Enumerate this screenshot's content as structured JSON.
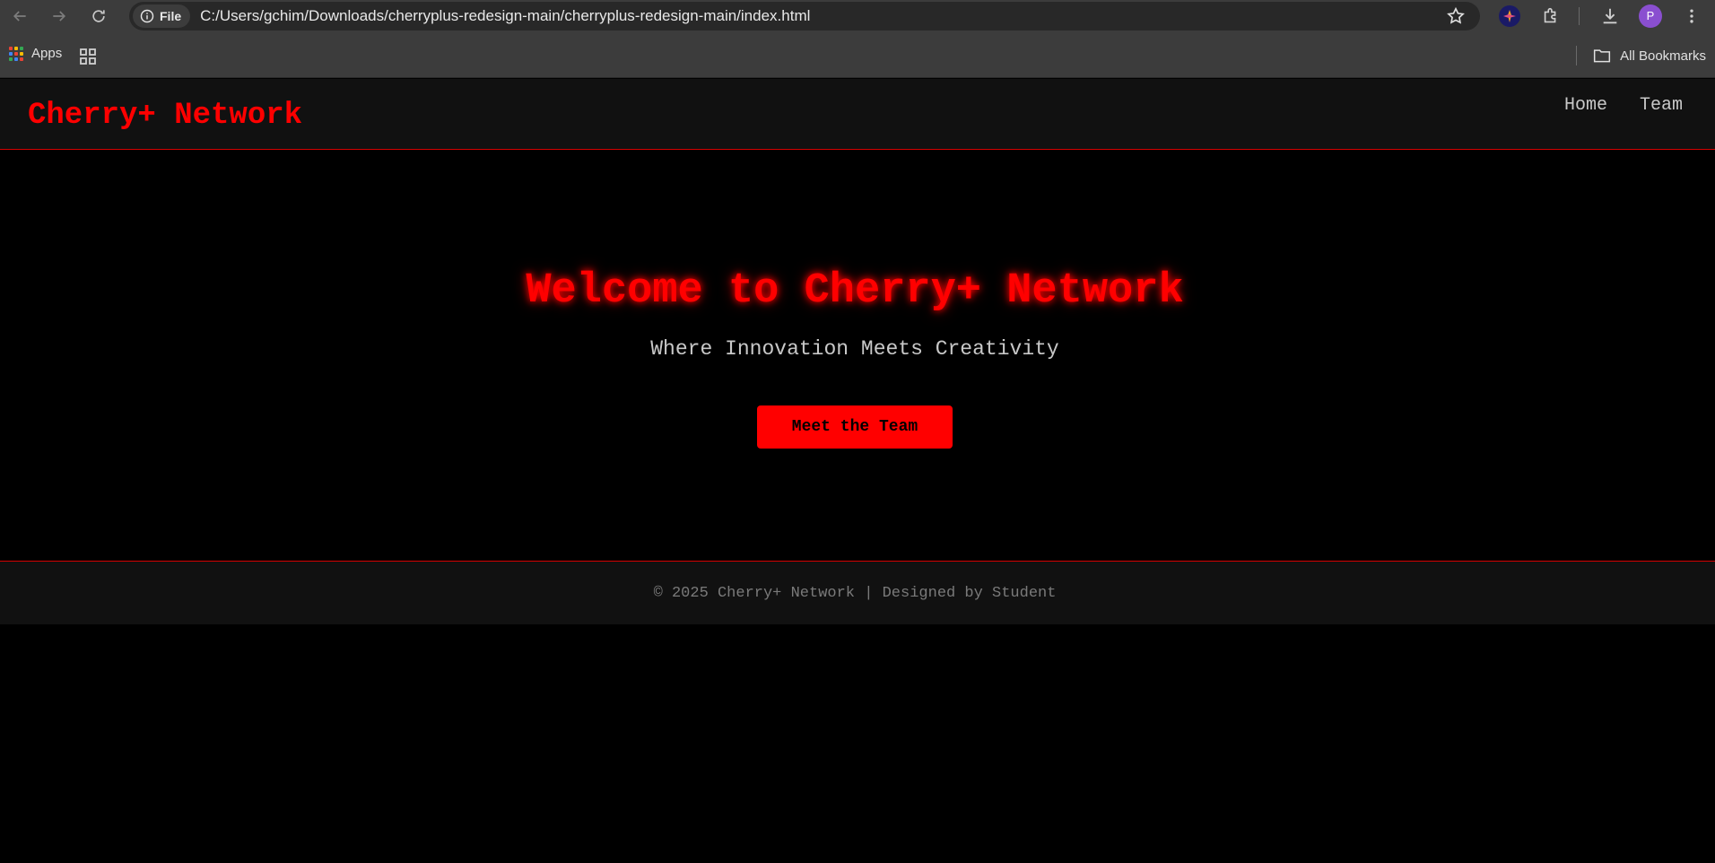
{
  "browser": {
    "site_info_label": "File",
    "url": "C:/Users/gchim/Downloads/cherryplus-redesign-main/cherryplus-redesign-main/index.html",
    "profile_initial": "P",
    "bookmarks": {
      "apps_label": "Apps",
      "all_bookmarks_label": "All Bookmarks"
    }
  },
  "site": {
    "logo": "Cherry+ Network",
    "nav": [
      {
        "label": "Home"
      },
      {
        "label": "Team"
      }
    ],
    "hero": {
      "title": "Welcome to Cherry+ Network",
      "subtitle": "Where Innovation Meets Creativity",
      "cta_label": "Meet the Team"
    },
    "footer": {
      "text": "© 2025 Cherry+ Network | Designed by Student"
    }
  },
  "colors": {
    "accent": "#ff0000",
    "header_bg": "#111111",
    "page_bg": "#000000"
  }
}
